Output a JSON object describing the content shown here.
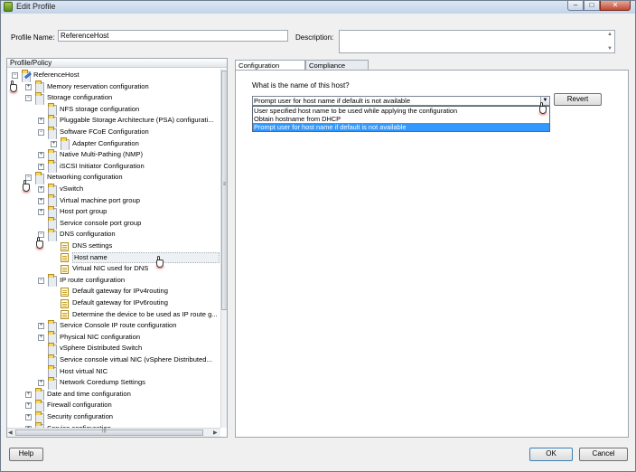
{
  "window": {
    "title": "Edit Profile",
    "min": "–",
    "max": "□",
    "close": "✕"
  },
  "profile": {
    "name_label": "Profile Name:",
    "name_value": "ReferenceHost",
    "description_label": "Description:",
    "description_value": ""
  },
  "tree": {
    "header": "Profile/Policy",
    "rows": [
      {
        "label": "ReferenceHost",
        "level": 0,
        "expander": "minus",
        "icon": "profile"
      },
      {
        "label": "Memory reservation configuration",
        "level": 1,
        "expander": "plus",
        "icon": "folder"
      },
      {
        "label": "Storage configuration",
        "level": 1,
        "expander": "minus",
        "icon": "folder"
      },
      {
        "label": "NFS storage configuration",
        "level": 2,
        "expander": "none",
        "icon": "folder"
      },
      {
        "label": "Pluggable Storage Architecture (PSA) configurati...",
        "level": 2,
        "expander": "plus",
        "icon": "folder"
      },
      {
        "label": "Software FCoE Configuration",
        "level": 2,
        "expander": "minus",
        "icon": "folder"
      },
      {
        "label": "Adapter Configuration",
        "level": 3,
        "expander": "plus",
        "icon": "folder"
      },
      {
        "label": "Native Multi-Pathing (NMP)",
        "level": 2,
        "expander": "plus",
        "icon": "folder"
      },
      {
        "label": "iSCSI Initiator Configuration",
        "level": 2,
        "expander": "plus",
        "icon": "folder"
      },
      {
        "label": "Networking configuration",
        "level": 1,
        "expander": "minus",
        "icon": "folder"
      },
      {
        "label": "vSwitch",
        "level": 2,
        "expander": "plus",
        "icon": "folder"
      },
      {
        "label": "Virtual machine port group",
        "level": 2,
        "expander": "plus",
        "icon": "folder"
      },
      {
        "label": "Host port group",
        "level": 2,
        "expander": "plus",
        "icon": "folder"
      },
      {
        "label": "Service console port group",
        "level": 2,
        "expander": "none",
        "icon": "folder"
      },
      {
        "label": "DNS configuration",
        "level": 2,
        "expander": "minus",
        "icon": "folder"
      },
      {
        "label": "DNS settings",
        "level": 3,
        "expander": "none",
        "icon": "doc"
      },
      {
        "label": "Host name",
        "level": 3,
        "expander": "none",
        "icon": "doc",
        "selected": true
      },
      {
        "label": "Virtual NIC used for DNS",
        "level": 3,
        "expander": "none",
        "icon": "doc"
      },
      {
        "label": "IP route configuration",
        "level": 2,
        "expander": "minus",
        "icon": "folder"
      },
      {
        "label": "Default gateway for IPv4routing",
        "level": 3,
        "expander": "none",
        "icon": "doc"
      },
      {
        "label": "Default gateway for IPv6routing",
        "level": 3,
        "expander": "none",
        "icon": "doc"
      },
      {
        "label": "Determine the device to be used as IP route g...",
        "level": 3,
        "expander": "none",
        "icon": "doc"
      },
      {
        "label": "Service Console IP route configuration",
        "level": 2,
        "expander": "plus",
        "icon": "folder"
      },
      {
        "label": "Physical NIC configuration",
        "level": 2,
        "expander": "plus",
        "icon": "folder"
      },
      {
        "label": "vSphere Distributed Switch",
        "level": 2,
        "expander": "none",
        "icon": "folder"
      },
      {
        "label": "Service console virtual NIC (vSphere Distributed...",
        "level": 2,
        "expander": "none",
        "icon": "folder"
      },
      {
        "label": "Host virtual NIC",
        "level": 2,
        "expander": "none",
        "icon": "folder"
      },
      {
        "label": "Network Coredump Settings",
        "level": 2,
        "expander": "plus",
        "icon": "folder"
      },
      {
        "label": "Date and time configuration",
        "level": 1,
        "expander": "plus",
        "icon": "folder"
      },
      {
        "label": "Firewall configuration",
        "level": 1,
        "expander": "plus",
        "icon": "folder"
      },
      {
        "label": "Security configuration",
        "level": 1,
        "expander": "plus",
        "icon": "folder"
      },
      {
        "label": "Service configuration",
        "level": 1,
        "expander": "plus",
        "icon": "folder"
      }
    ]
  },
  "tabs": [
    {
      "label": "Configuration Details",
      "active": true
    },
    {
      "label": "Compliance Details",
      "active": false
    }
  ],
  "details": {
    "question": "What is the name of this host?",
    "selected_option": "Prompt user for host name if default is not available",
    "options": [
      "User specified host name to be used while applying the configuration",
      "Obtain hostname from DHCP",
      "Prompt user for host name if default is not available"
    ],
    "highlighted_index": 2,
    "revert_label": "Revert"
  },
  "footer": {
    "help_label": "Help",
    "ok_label": "OK",
    "cancel_label": "Cancel"
  }
}
